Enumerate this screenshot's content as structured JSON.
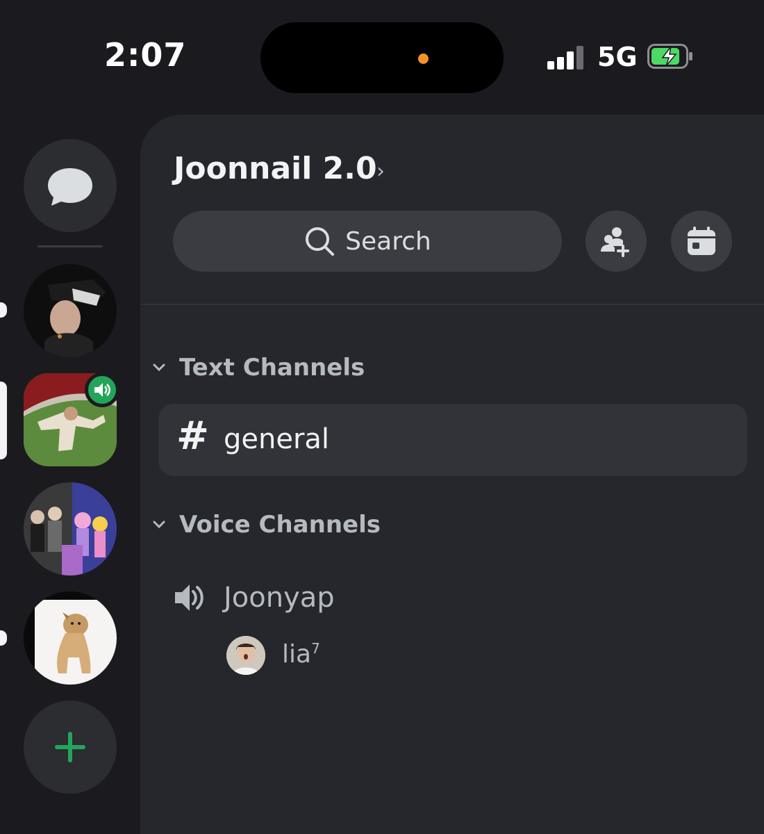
{
  "status_bar": {
    "time": "2:07",
    "network": "5G"
  },
  "server": {
    "name": "Joonnail 2.0",
    "chevron": "›"
  },
  "search": {
    "label": "Search"
  },
  "actions": [
    {
      "icon": "add-friend-icon"
    },
    {
      "icon": "calendar-icon"
    }
  ],
  "categories": {
    "text": {
      "label": "Text Channels"
    },
    "voice": {
      "label": "Voice Channels"
    }
  },
  "text_channels": [
    {
      "symbol": "#",
      "name": "general"
    }
  ],
  "voice_channels": [
    {
      "name": "Joonyap",
      "users": [
        {
          "name": "lia",
          "superscript": "7"
        }
      ]
    }
  ],
  "colors": {
    "accent_green": "#23a559",
    "panel": "#26272c",
    "rail": "#1b1b1f",
    "orange_dot": "#f4922a"
  }
}
